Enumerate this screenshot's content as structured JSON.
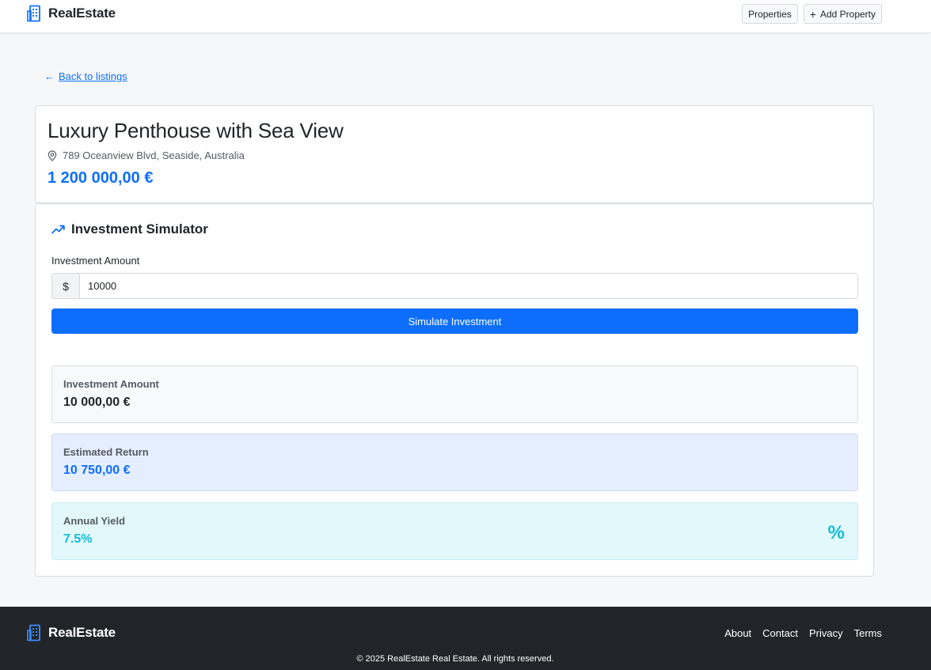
{
  "header": {
    "brand": "RealEstate",
    "nav": {
      "properties": "Properties",
      "add_property": "Add Property"
    }
  },
  "back_link": "Back to listings",
  "property": {
    "title": "Luxury Penthouse with Sea View",
    "address": "789 Oceanview Blvd, Seaside, Australia",
    "price": "1 200 000,00 €"
  },
  "simulator": {
    "title": "Investment Simulator",
    "amount_label": "Investment Amount",
    "currency_prefix": "$",
    "amount_value": "10000",
    "button": "Simulate Investment",
    "results": {
      "investment": {
        "label": "Investment Amount",
        "value": "10 000,00 €"
      },
      "return": {
        "label": "Estimated Return",
        "value": "10 750,00 €"
      },
      "yield": {
        "label": "Annual Yield",
        "value": "7.5%"
      }
    }
  },
  "footer": {
    "brand": "RealEstate",
    "links": {
      "about": "About",
      "contact": "Contact",
      "privacy": "Privacy",
      "terms": "Terms"
    },
    "copyright": "© 2025 RealEstate Real Estate. All rights reserved."
  },
  "colors": {
    "primary": "#0d6efd",
    "info": "#12bcd8",
    "footer_bg": "#212529"
  },
  "icons": {
    "brand": "building-icon",
    "back": "arrow-left-icon",
    "address": "geo-pin-icon",
    "simulator": "graph-up-arrow-icon",
    "yield": "percent-icon",
    "add": "plus-icon"
  }
}
